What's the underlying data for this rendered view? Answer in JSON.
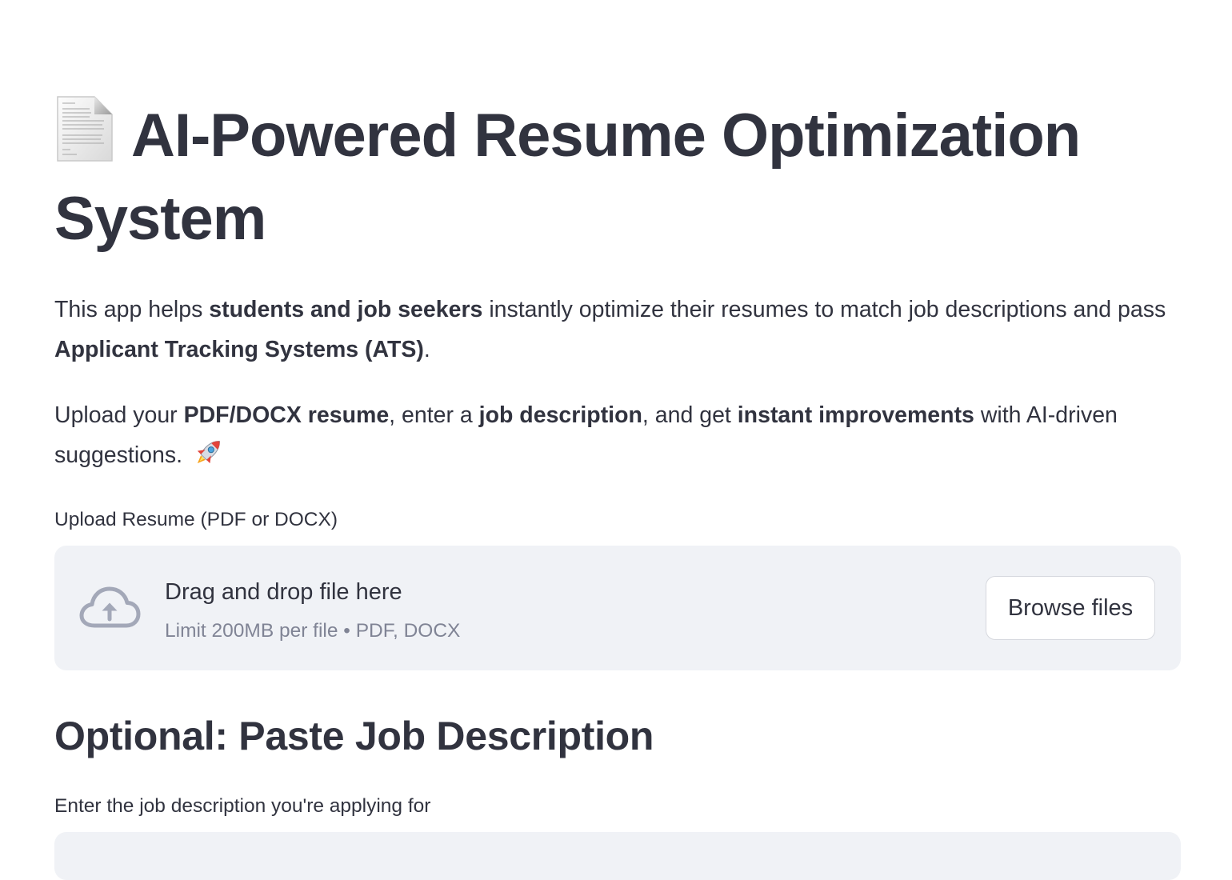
{
  "header": {
    "title": "AI-Powered Resume Optimization System",
    "title_icon": "page-facing-up-icon"
  },
  "intro": {
    "p1": {
      "t1": "This app helps ",
      "b1": "students and job seekers",
      "t2": " instantly optimize their resumes to match job descriptions and pass ",
      "b2": "Applicant Tracking Systems (ATS)",
      "t3": "."
    },
    "p2": {
      "t1": "Upload your ",
      "b1": "PDF/DOCX resume",
      "t2": ", enter a ",
      "b2": "job description",
      "t3": ", and get ",
      "b3": "instant improvements",
      "t4": " with AI-driven suggestions. ",
      "icon": "rocket-icon"
    }
  },
  "uploader": {
    "label": "Upload Resume (PDF or DOCX)",
    "drop_text": "Drag and drop file here",
    "limit_text": "Limit 200MB per file • PDF, DOCX",
    "button_label": "Browse files",
    "icon": "cloud-upload-icon"
  },
  "job_description": {
    "heading": "Optional: Paste Job Description",
    "label": "Enter the job description you're applying for",
    "value": ""
  },
  "colors": {
    "text": "#31333f",
    "muted": "#808495",
    "dropzone_bg": "#f0f2f6",
    "button_border": "#d6d8de",
    "icon": "#a3a8b8"
  }
}
